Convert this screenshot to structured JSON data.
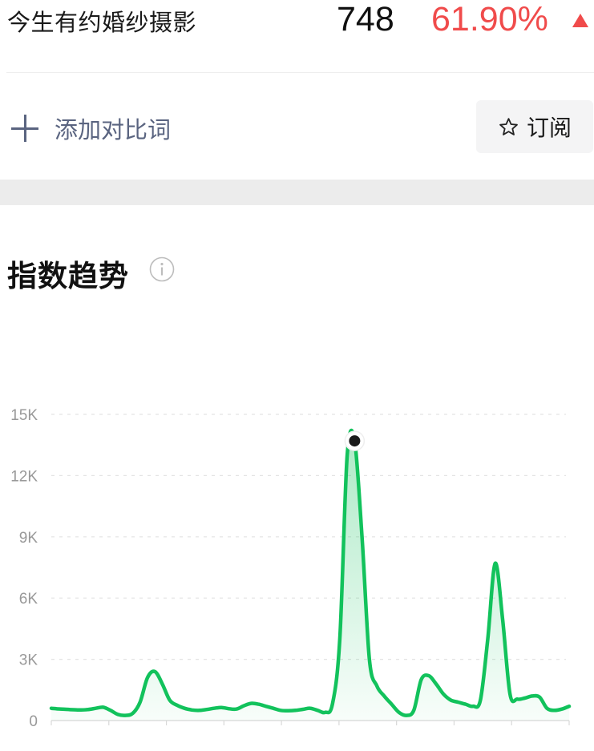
{
  "header": {
    "keyword": "今生有约婚纱摄影",
    "index_value": "748",
    "change_pct": "61.90%",
    "change_direction_icon": "triangle-up-icon",
    "change_color": "#f04b4b"
  },
  "actions": {
    "add_compare_label": "添加对比词",
    "add_icon": "plus-icon",
    "subscribe_label": "订阅",
    "subscribe_icon": "star-icon"
  },
  "section": {
    "title": "指数趋势",
    "info_icon": "info-icon"
  },
  "chart_data": {
    "type": "area",
    "line_color": "#12c25c",
    "y_ticks": [
      "15K",
      "12K",
      "9K",
      "6K",
      "3K",
      "0"
    ],
    "ylim": [
      0,
      15000
    ],
    "grid": true,
    "highlighted_point_index": 41,
    "series": [
      {
        "values": [
          600,
          570,
          550,
          530,
          520,
          540,
          600,
          650,
          500,
          300,
          250,
          350,
          900,
          2100,
          2400,
          1800,
          1000,
          750,
          600,
          520,
          500,
          540,
          600,
          640,
          580,
          560,
          720,
          840,
          800,
          700,
          600,
          500,
          480,
          500,
          550,
          600,
          500,
          400,
          800,
          4000,
          13000,
          13700,
          9000,
          3000,
          1700,
          1200,
          800,
          400,
          250,
          500,
          2000,
          2200,
          1800,
          1300,
          1000,
          900,
          800,
          700,
          1000,
          4000,
          7700,
          5000,
          1300,
          1050,
          1100,
          1200,
          1150,
          600,
          500,
          560,
          700
        ]
      }
    ]
  }
}
